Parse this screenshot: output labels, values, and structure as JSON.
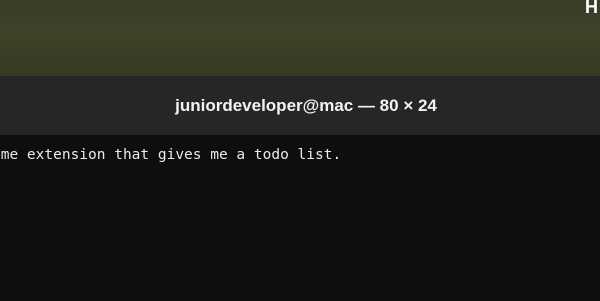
{
  "desktop": {
    "corner_text": "H"
  },
  "window": {
    "title": "juniordeveloper@mac — 80 × 24"
  },
  "terminal": {
    "lines": [
      "ome extension that gives me a todo list."
    ]
  }
}
